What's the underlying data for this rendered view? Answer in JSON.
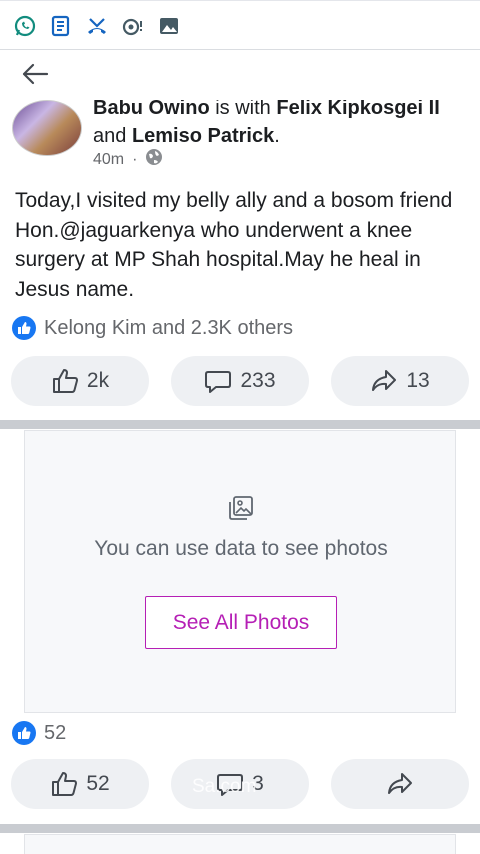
{
  "status_bar": {
    "icons": [
      "whatsapp-icon",
      "news-icon",
      "missed-call-icon",
      "notification-icon",
      "gallery-icon"
    ]
  },
  "post": {
    "author": "Babu Owino",
    "with_text": "is with",
    "tagged_1": "Felix Kipkosgei II",
    "and_text": "and",
    "tagged_2": "Lemiso Patrick",
    "time": "40m",
    "separator": "·",
    "text": "Today,I visited my belly ally and a bosom friend Hon.@jaguarkenya who underwent a knee surgery at MP Shah hospital.May he heal in Jesus name.",
    "reactions_text": "Kelong Kim and 2.3K others",
    "like_count": "2k",
    "comment_count": "233",
    "share_count": "13"
  },
  "photo_post": {
    "data_message": "You can use data to see photos",
    "see_all_label": "See All Photos",
    "reactions_text": "52",
    "like_count": "52",
    "comment_count": "3",
    "watermark": "Sa.com"
  },
  "colors": {
    "accent_blue": "#1877f2",
    "see_all": "#b51fb5",
    "button_bg": "#eef0f3",
    "divider": "#c9ccd1"
  }
}
